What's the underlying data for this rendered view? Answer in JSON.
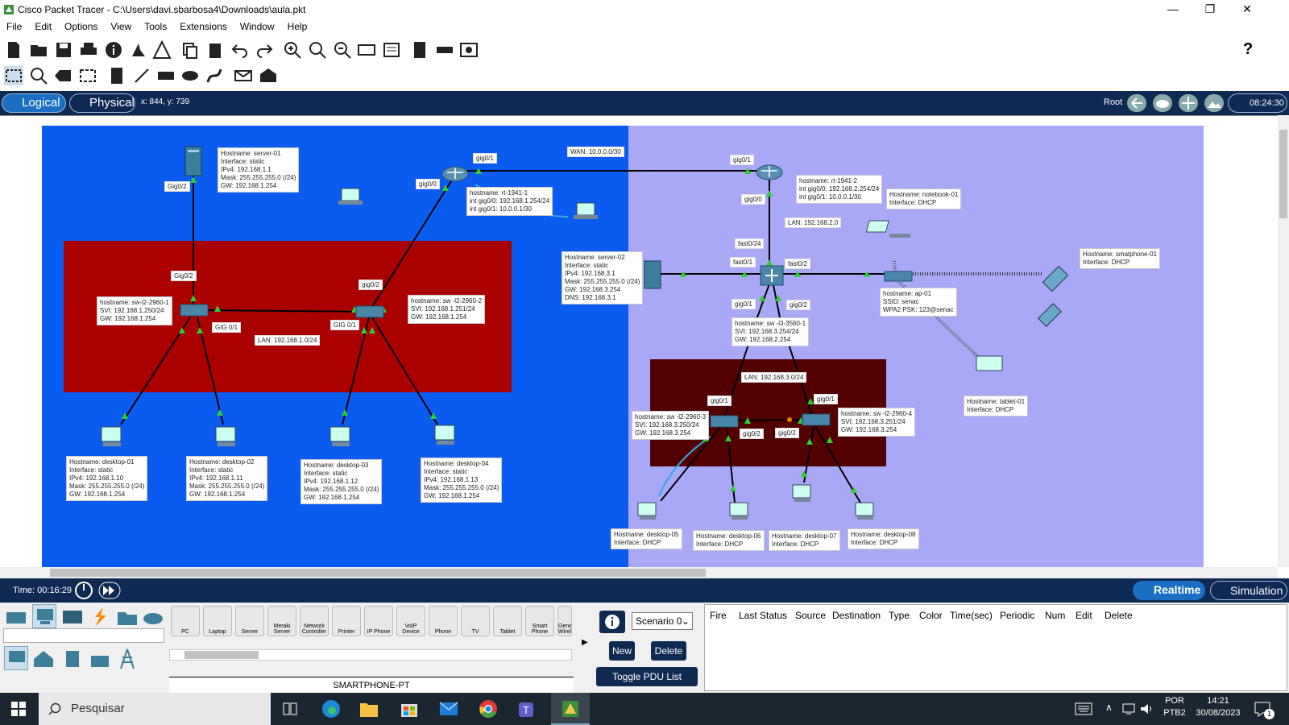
{
  "window": {
    "title": "Cisco Packet Tracer - C:\\Users\\davi.sbarbosa4\\Downloads\\aula.pkt",
    "min": "—",
    "max": "❐",
    "close": "✕"
  },
  "menu": [
    "File",
    "Edit",
    "Options",
    "View",
    "Tools",
    "Extensions",
    "Window",
    "Help"
  ],
  "help_icon": "?",
  "modebar": {
    "logical": "Logical",
    "physical": "Physical",
    "coords": "x: 844, y: 739",
    "root": "Root",
    "time": "08:24:30"
  },
  "net": {
    "wan": "WAN: 10.0.0.0/30",
    "lan1": "LAN: 192.168.1.0/24",
    "lan2": "LAN: 192.168.2.0",
    "lan3": "LAN: 192.168.3.0/24",
    "server01": "Hostname: server-01\nInterface: static\nIPv4: 192.168.1.1\nMask: 255.255.255.0 (/24)\nGW: 192.168.1.254",
    "rt1": "hostname: rt-1941-1\nint gig0/0: 192.168.1.254/24\nint gig0/1: 10.0.0.1/30",
    "rt2": "hostname: rt-1941-2\nint gig0/0: 192.168.2.254/24\nint gig0/1: 10.0.0.1/30",
    "notebook01": "Hostname: notebook-01\nInterface: DHCP",
    "server02": "Hostname: server-02\nInterface: static\nIPv4: 192.168.3.1\nMask: 255.255.255.0 (/24)\nGW: 192.168.3.254\nDNS: 192.168.3.1",
    "sw1": "hostname: sw-l2-2960-1\nSVI: 192.168.1.250/24\nGW: 192.168.1.254",
    "sw2": "hostname: sw -l2-2960-2\nSVI: 192.168.1.251/24\nGW: 192.168.1.254",
    "sw3560": "hostname: sw -l3-3560-1\nSVI: 192.168.3.254/24\nGW: 192.168.2.254",
    "ap": "hostname: ap-01\nSSID: senac\nWPA2 PSK: 123@senac",
    "smartphone": "Hostname: smatphone-01\nInterface: DHCP",
    "tablet": "Hostname: tablet-01\nInterface: DHCP",
    "sw3": "hostname: sw -l2-2960-3\nSVI: 192.168.3.250/24\nGW: 192.168.3.254",
    "sw4": "hostname: sw -l2-2960-4\nSVI: 192.168.3.251/24\nGW: 192.168.3.254",
    "d1": "Hostname: desktop-01\nInterface: static\nIPv4: 192.168.1.10\nMask: 255.255.255.0 (/24)\nGW: 192.168.1.254",
    "d2": "Hostname: desktop-02\nInterface: static\nIPv4: 192.168.1.11\nMask: 255.255.255.0 (/24)\nGW: 192.168.1.254",
    "d3": "Hostname: desktop-03\nInterface: static\nIPv4: 192.168.1.12\nMask: 255.255.255.0 (/24)\nGW: 192.168.1.254",
    "d4": "Hostname: desktop-04\nInterface: static\nIPv4: 192.168.1.13\nMask: 255.255.255.0 (/24)\nGW: 192.168.1.254",
    "d5": "Hostname: desktop-05\nInterface: DHCP",
    "d6": "Hostname: desktop-06\nInterface: DHCP",
    "d7": "Hostname: desktop-07\nInterface: DHCP",
    "d8": "Hostname: desktop-08\nInterface: DHCP",
    "ports": {
      "gig02a": "Gig0/2",
      "gig02b": "Gig0/2",
      "gig01a": "gig0/1",
      "gig00a": "gig0/0",
      "gig02c": "gig0/2",
      "gig01b": "GIG 0/1",
      "gig01c": "GIG 0/1",
      "gig01d": "gig0/1",
      "gig00b": "gig0/0",
      "fast024": "fast0/24",
      "fast01": "fast0/1",
      "fast02": "fast0/2",
      "gig01e": "gig0/1",
      "gig02d": "gig0/2",
      "gig01f": "gig0/1",
      "gig01g": "gig0/1",
      "gig02e": "gig0/2",
      "gig02f": "gig0/2"
    }
  },
  "timebar": {
    "time": "Time: 00:16:29",
    "realtime": "Realtime",
    "simulation": "Simulation"
  },
  "devices": [
    "PC",
    "Laptop",
    "Server",
    "Meraki Server",
    "Network Controller",
    "Printer",
    "IP Phone",
    "VoIP Device",
    "Phone",
    "TV",
    "Tablet",
    "Smart Phone",
    "Generic Wireless"
  ],
  "selected_device": "SMARTPHONE-PT",
  "scenario": {
    "value": "Scenario 0",
    "new": "New",
    "delete": "Delete",
    "toggle": "Toggle PDU List Window"
  },
  "pdu_headers": [
    "Fire",
    "Last Status",
    "Source",
    "Destination",
    "Type",
    "Color",
    "Time(sec)",
    "Periodic",
    "Num",
    "Edit",
    "Delete"
  ],
  "taskbar": {
    "search": "Pesquisar",
    "lang1": "POR",
    "lang2": "PTB2",
    "time": "14:21",
    "date": "30/08/2023",
    "notif": "1"
  }
}
